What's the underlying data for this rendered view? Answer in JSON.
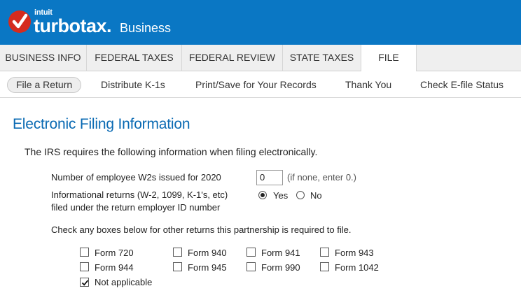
{
  "header": {
    "brand_small": "intuit",
    "brand": "turbotax.",
    "product": "Business",
    "colors": {
      "bar": "#0a77c4",
      "check": "#d52b1e"
    },
    "icon": "checkmark-icon"
  },
  "tabs": [
    {
      "label": "BUSINESS INFO"
    },
    {
      "label": "FEDERAL TAXES"
    },
    {
      "label": "FEDERAL REVIEW"
    },
    {
      "label": "STATE TAXES"
    },
    {
      "label": "FILE",
      "active": true
    }
  ],
  "subnav": [
    {
      "label": "File a Return",
      "active": true
    },
    {
      "label": "Distribute K-1s"
    },
    {
      "label": "Print/Save for Your Records"
    },
    {
      "label": "Thank You"
    },
    {
      "label": "Check E-file Status"
    }
  ],
  "page": {
    "title": "Electronic Filing Information",
    "intro": "The IRS requires the following information when filing electronically.",
    "w2": {
      "label": "Number of employee W2s issued for 2020",
      "value": "0",
      "hint": "(if none, enter 0.)"
    },
    "info_returns": {
      "label_line1": "Informational returns (W-2, 1099, K-1's, etc)",
      "label_line2": "filed under the return employer ID number",
      "options": [
        {
          "label": "Yes",
          "selected": true
        },
        {
          "label": "No",
          "selected": false
        }
      ]
    },
    "check_prompt": "Check any boxes below for other returns this partnership is required to file.",
    "checkboxes": [
      {
        "label": "Form 720",
        "checked": false
      },
      {
        "label": "Form 940",
        "checked": false
      },
      {
        "label": "Form 941",
        "checked": false
      },
      {
        "label": "Form 943",
        "checked": false
      },
      {
        "label": "Form 944",
        "checked": false
      },
      {
        "label": "Form 945",
        "checked": false
      },
      {
        "label": "Form 990",
        "checked": false
      },
      {
        "label": "Form 1042",
        "checked": false
      },
      {
        "label": "Not applicable",
        "checked": true
      }
    ]
  }
}
